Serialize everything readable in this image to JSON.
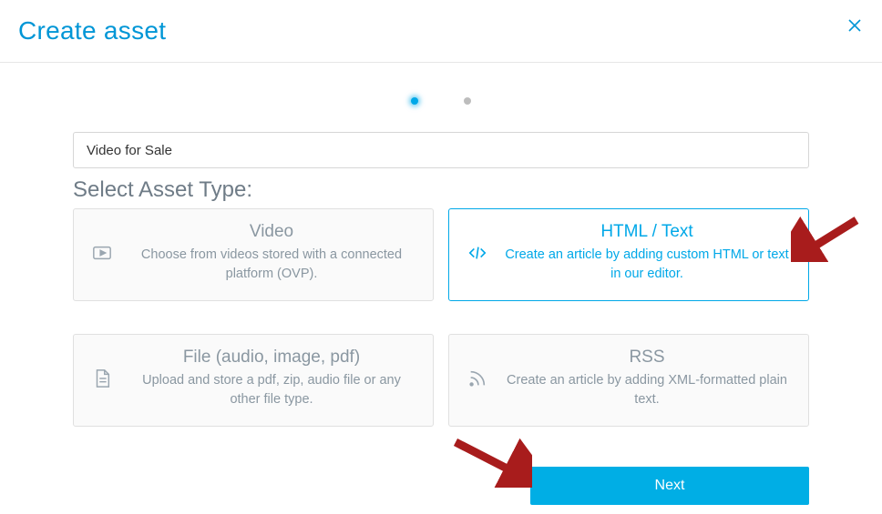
{
  "header": {
    "title": "Create asset"
  },
  "stepper": {
    "active_index": 0,
    "total": 2
  },
  "form": {
    "name_value": "Video for Sale",
    "section_label": "Select Asset Type:"
  },
  "types": [
    {
      "key": "video",
      "title": "Video",
      "desc": "Choose from videos stored with a connected platform (OVP).",
      "icon": "play-video-icon",
      "selected": false
    },
    {
      "key": "html",
      "title": "HTML / Text",
      "desc": "Create an article by adding custom HTML or text in our editor.",
      "icon": "code-icon",
      "selected": true
    },
    {
      "key": "file",
      "title": "File (audio, image, pdf)",
      "desc": "Upload and store a pdf, zip, audio file or any other file type.",
      "icon": "file-icon",
      "selected": false
    },
    {
      "key": "rss",
      "title": "RSS",
      "desc": "Create an article by adding XML-formatted plain text.",
      "icon": "rss-icon",
      "selected": false
    }
  ],
  "footer": {
    "next_label": "Next"
  },
  "annotations": {
    "arrow_top": "points to HTML / Text card",
    "arrow_bottom": "points to Next button"
  }
}
